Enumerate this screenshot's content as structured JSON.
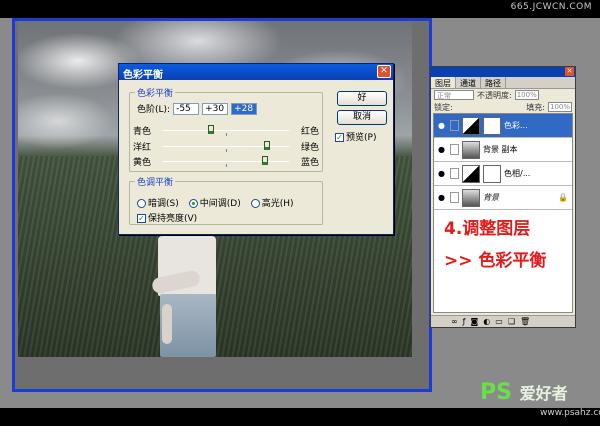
{
  "watermark_top": "665.JCWCN.COM",
  "dialog": {
    "title": "色彩平衡",
    "close": "✕",
    "color_balance_group": "色彩平衡",
    "levels_label": "色阶(L):",
    "levels": [
      "-55",
      "+30",
      "+28"
    ],
    "sliders": [
      {
        "left": "青色",
        "right": "红色"
      },
      {
        "left": "洋红",
        "right": "绿色"
      },
      {
        "left": "黄色",
        "right": "蓝色"
      }
    ],
    "tone_group": "色调平衡",
    "tones": [
      "暗调(S)",
      "中间调(D)",
      "高光(H)"
    ],
    "selected_tone": "中间调(D)",
    "preserve_luminosity": "保持亮度(V)",
    "ok": "好",
    "cancel": "取消",
    "preview": "预览(P)"
  },
  "layers_panel": {
    "tabs": [
      "图层",
      "通道",
      "路径"
    ],
    "blend_mode": "正常",
    "opacity_label": "不透明度:",
    "opacity": "100%",
    "lock_label": "锁定:",
    "fill_label": "填充:",
    "fill": "100%",
    "layers": [
      {
        "name": "色彩...",
        "type": "adjustment",
        "selected": true
      },
      {
        "name": "背景 副本",
        "type": "photo",
        "selected": false
      },
      {
        "name": "色相/...",
        "type": "adjustment",
        "selected": false
      },
      {
        "name": "背景",
        "type": "photo",
        "selected": false
      }
    ]
  },
  "annotation": {
    "line1": "4.调整图层",
    "line2": ">> 色彩平衡"
  },
  "brand": {
    "logo_ps": "PS",
    "logo_text": "爱好者",
    "url": "www.psahz.com"
  }
}
